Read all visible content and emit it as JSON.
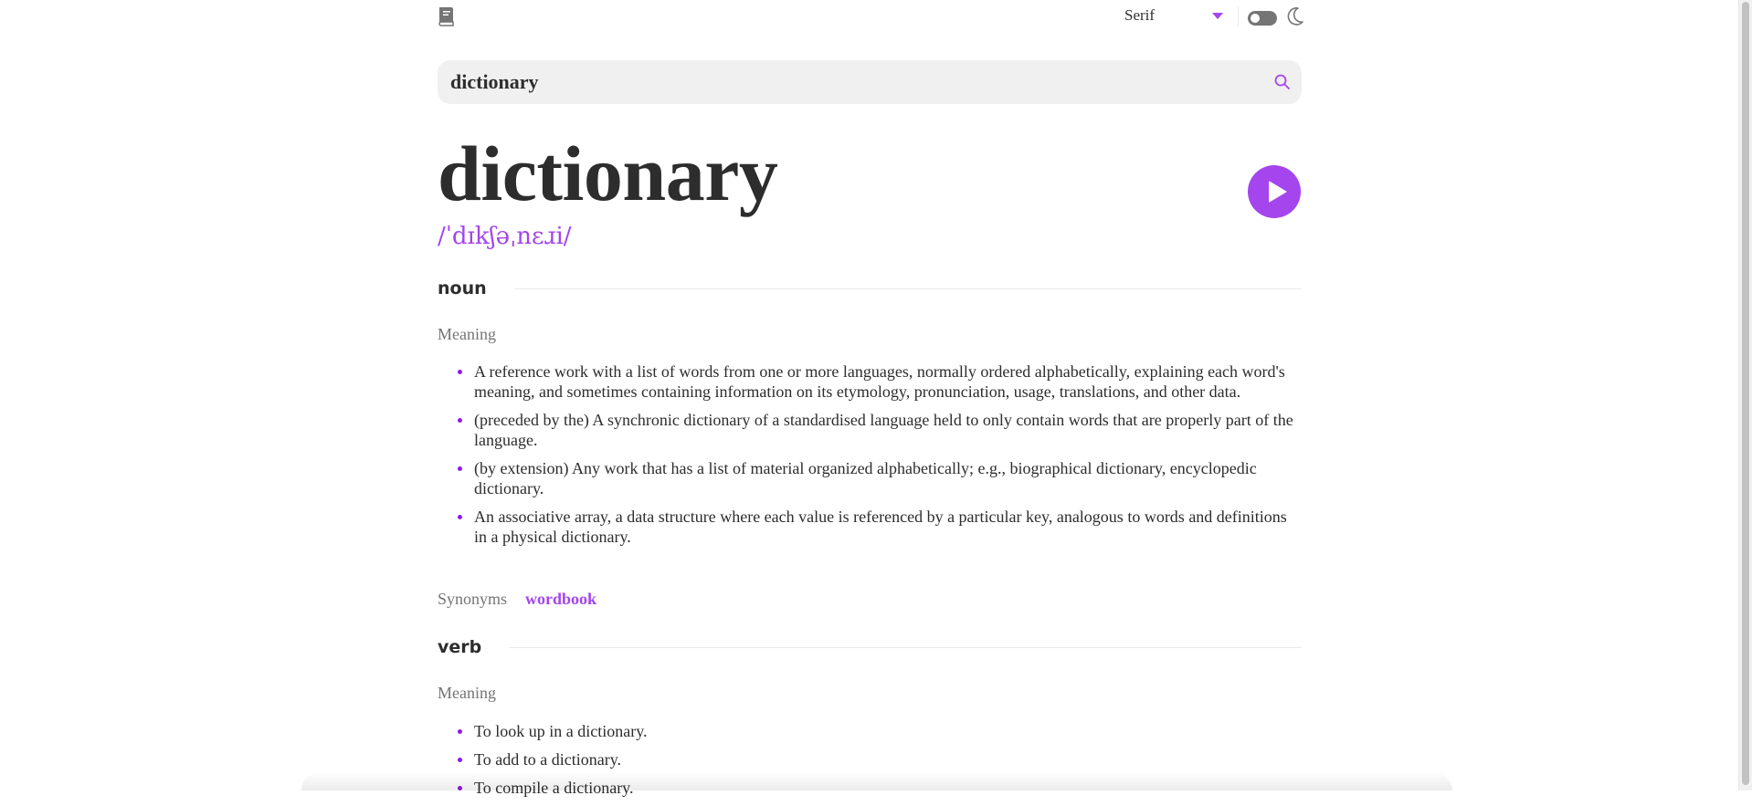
{
  "topbar": {
    "book_icon": "book-icon",
    "font_select": {
      "selected": "Serif",
      "icon": "chevron-down-icon"
    },
    "theme_toggle": {
      "state": "off"
    },
    "moon_icon": "moon-icon"
  },
  "search": {
    "value": "dictionary",
    "icon": "search-icon"
  },
  "entry": {
    "word": "dictionary",
    "phonetic": "/ˈdɪkʃəˌnɛɹi/",
    "play_icon": "play-icon"
  },
  "meanings": [
    {
      "part_of_speech": "noun",
      "meaning_label": "Meaning",
      "definitions": [
        "A reference work with a list of words from one or more languages, normally ordered alphabetically, explaining each word's meaning, and sometimes containing information on its etymology, pronunciation, usage, translations, and other data.",
        "(preceded by the) A synchronic dictionary of a standardised language held to only contain words that are properly part of the language.",
        "(by extension) Any work that has a list of material organized alphabetically; e.g., biographical dictionary, encyclopedic dictionary.",
        "An associative array, a data structure where each value is referenced by a particular key, analogous to words and definitions in a physical dictionary."
      ],
      "synonyms_label": "Synonyms",
      "synonyms": [
        "wordbook"
      ]
    },
    {
      "part_of_speech": "verb",
      "meaning_label": "Meaning",
      "definitions": [
        "To look up in a dictionary.",
        "To add to a dictionary.",
        "To compile a dictionary."
      ]
    }
  ],
  "colors": {
    "accent": "#a445ed",
    "text": "#2d2d2d",
    "muted": "#757575",
    "divider": "#e9e9e9",
    "search_bg": "#f0f0f0"
  }
}
